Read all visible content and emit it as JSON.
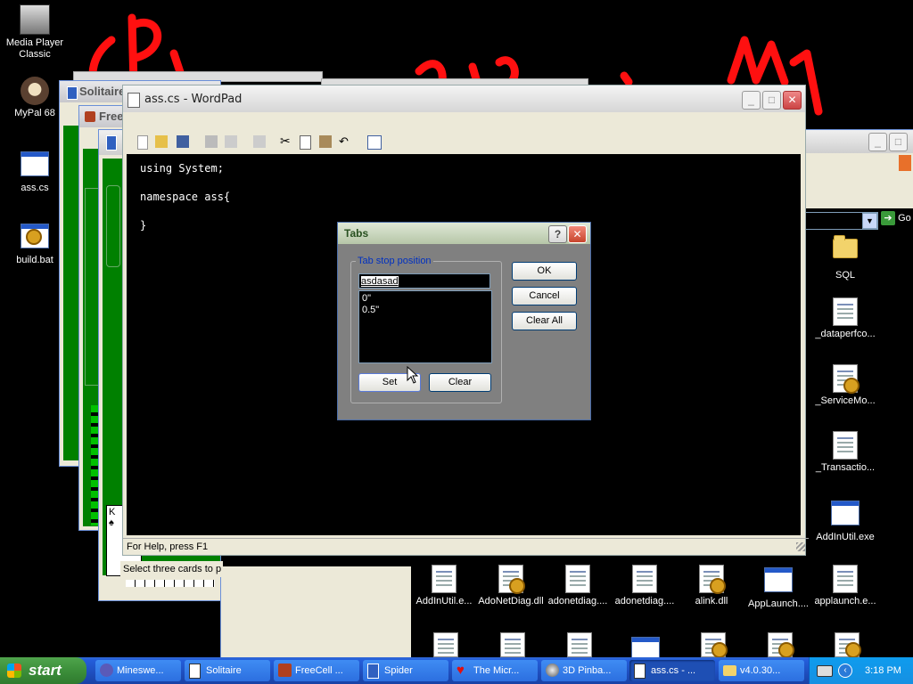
{
  "desktop_icons_left": [
    {
      "label": "Media Player Classic",
      "icon": "media-player-icon"
    },
    {
      "label": "MyPal 68",
      "icon": "mypal-icon"
    },
    {
      "label": "ass.cs",
      "icon": "cs-file-icon"
    },
    {
      "label": "build.bat",
      "icon": "bat-file-icon"
    }
  ],
  "explorer_icons": [
    {
      "label": "SQL",
      "icon": "folder-icon"
    },
    {
      "label": "_dataperfco...",
      "icon": "file-icon"
    },
    {
      "label": "_ServiceMo...",
      "icon": "dll-file-icon"
    },
    {
      "label": "_Transactio...",
      "icon": "file-icon"
    },
    {
      "label": "AddInUtil.exe",
      "icon": "exe-file-icon"
    }
  ],
  "explorer_bottom_icons": [
    {
      "label": "AddInUtil.e...",
      "icon": "file-icon"
    },
    {
      "label": "AdoNetDiag.dll",
      "icon": "dll-file-icon"
    },
    {
      "label": "adonetdiag....",
      "icon": "file-icon"
    },
    {
      "label": "adonetdiag....",
      "icon": "file-icon"
    },
    {
      "label": "alink.dll",
      "icon": "dll-file-icon"
    },
    {
      "label": "AppLaunch....",
      "icon": "exe-file-icon"
    },
    {
      "label": "applaunch.e...",
      "icon": "file-icon"
    }
  ],
  "explorer": {
    "go_label": "Go"
  },
  "solitaire": {
    "title": "Solitaire"
  },
  "freecell": {
    "title": "Free",
    "status": "Select three cards to p"
  },
  "wordpad": {
    "title": "ass.cs - WordPad",
    "document_lines": [
      "using System;",
      "namespace ass{",
      "}"
    ],
    "status": "For Help, press F1"
  },
  "dialog": {
    "title": "Tabs",
    "group_label": "Tab stop position",
    "input_value": "asdasad",
    "stops": [
      "0\"",
      "0.5\""
    ],
    "ok_label": "OK",
    "cancel_label": "Cancel",
    "clear_all_label": "Clear All",
    "set_label": "Set",
    "clear_label": "Clear"
  },
  "taskbar": {
    "start_label": "start",
    "tasks": [
      {
        "label": "Mineswe...",
        "icon": "minesweeper-icon"
      },
      {
        "label": "Solitaire",
        "icon": "solitaire-icon"
      },
      {
        "label": "FreeCell ...",
        "icon": "freecell-icon"
      },
      {
        "label": "Spider",
        "icon": "spider-icon"
      },
      {
        "label": "The Micr...",
        "icon": "heart-icon"
      },
      {
        "label": "3D Pinba...",
        "icon": "pinball-icon"
      },
      {
        "label": "ass.cs - ...",
        "icon": "wordpad-icon"
      },
      {
        "label": "v4.0.30...",
        "icon": "folder-icon"
      }
    ],
    "clock": "3:18 PM"
  },
  "colors": {
    "scribble": "#ff1010",
    "desktop": "#000000",
    "taskbar": "#245edb",
    "start": "#3c8f3a"
  }
}
